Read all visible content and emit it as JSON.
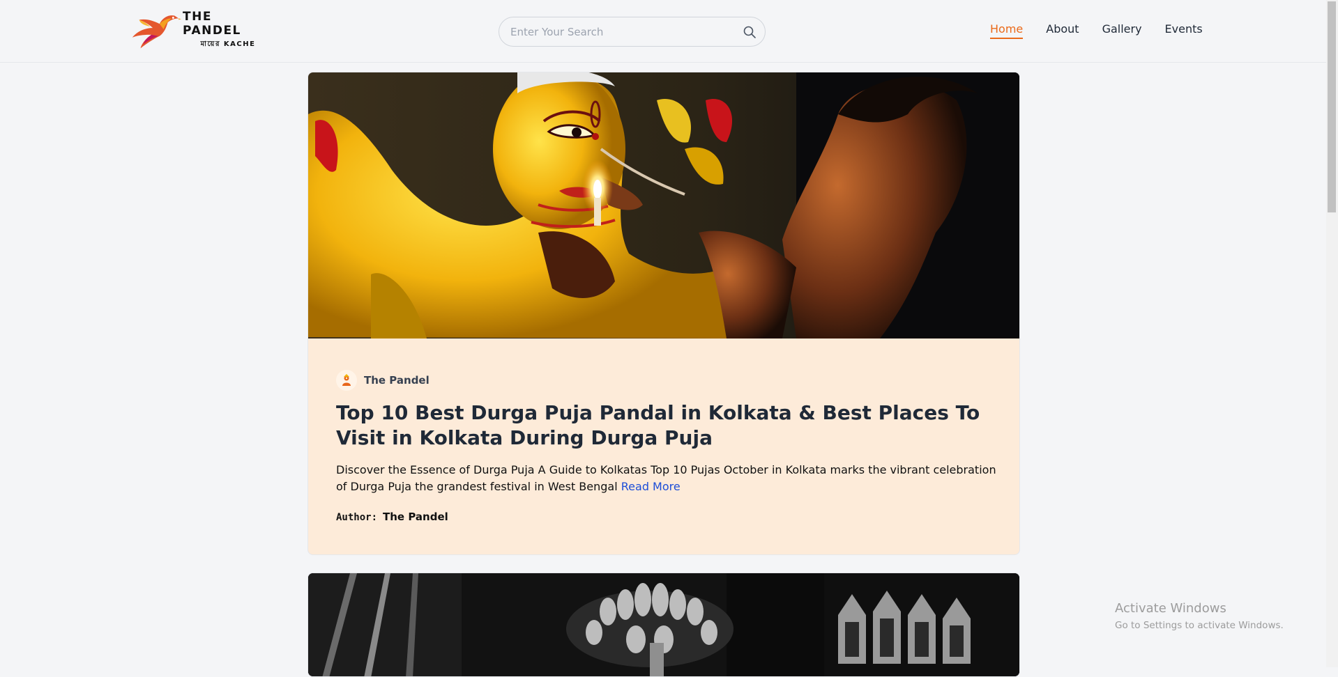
{
  "brand": {
    "name": "THE PANDEL",
    "tagline": "মায়ের KACHE"
  },
  "search": {
    "placeholder": "Enter Your Search",
    "value": ""
  },
  "nav": {
    "items": [
      {
        "label": "Home",
        "active": true
      },
      {
        "label": "About",
        "active": false
      },
      {
        "label": "Gallery",
        "active": false
      },
      {
        "label": "Events",
        "active": false
      }
    ]
  },
  "colors": {
    "accent": "#ea6a1a",
    "card_bg": "#fdebd9",
    "link": "#1d4ed8",
    "page_bg": "#f4f5f7"
  },
  "posts": [
    {
      "source": "The Pandel",
      "title": "Top 10 Best Durga Puja Pandal in Kolkata & Best Places To Visit in Kolkata During Durga Puja",
      "excerpt": "Discover the Essence of Durga Puja A Guide to Kolkatas Top 10 Pujas October in Kolkata marks the vibrant celebration of Durga Puja the grandest festival in West Bengal",
      "read_more": "Read More",
      "author_label": "Author:",
      "author": "The Pandel"
    }
  ],
  "system": {
    "activate_title": "Activate Windows",
    "activate_sub": "Go to Settings to activate Windows."
  }
}
